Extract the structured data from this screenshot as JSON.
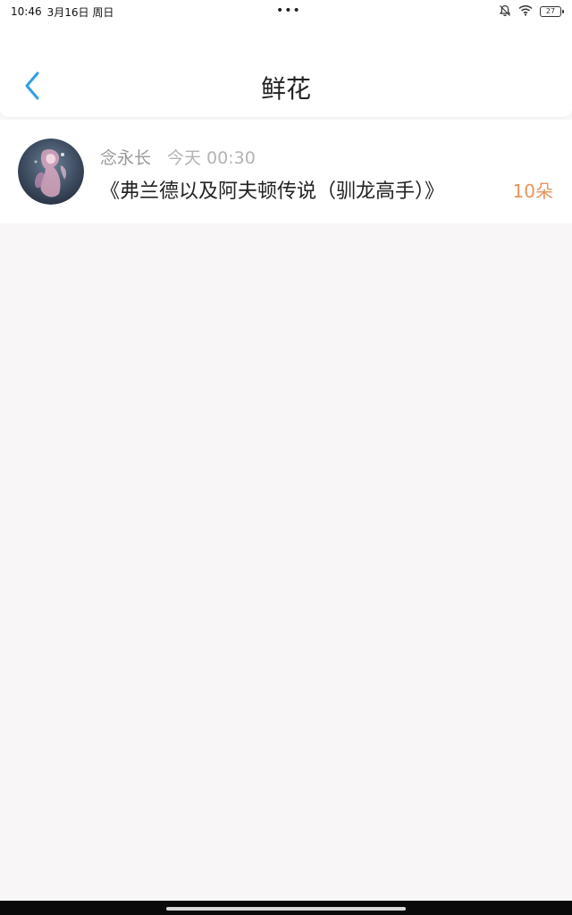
{
  "status_bar": {
    "time": "10:46",
    "date": "3月16日 周日",
    "dots": "•••",
    "battery": "27",
    "icons": [
      "bell-off-icon",
      "wifi-icon",
      "battery-icon"
    ]
  },
  "header": {
    "title": "鲜花",
    "back_icon": "chevron-left-icon",
    "accent": "#2ea0e6"
  },
  "list": [
    {
      "user": "念永长",
      "time": "今天 00:30",
      "title": "《弗兰德以及阿夫顿传说（驯龙高手）》",
      "count": "10朵",
      "count_color": "#e8935b"
    }
  ]
}
